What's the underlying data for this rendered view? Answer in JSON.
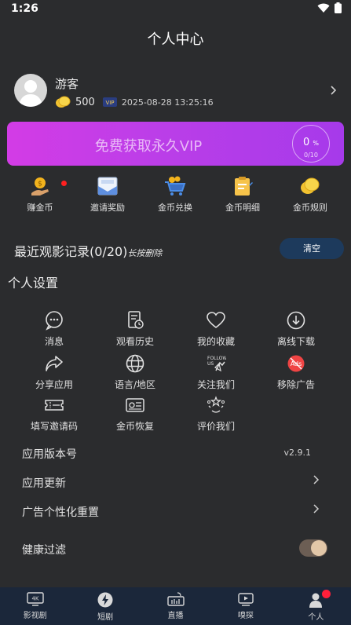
{
  "status": {
    "time": "1:26"
  },
  "header": {
    "title": "个人中心"
  },
  "profile": {
    "name": "游客",
    "coins": "500",
    "vip_badge": "VIP",
    "date": "2025-08-28 13:25:16"
  },
  "vip": {
    "label": "免费获取永久VIP",
    "percent": "0",
    "percent_sign": "%",
    "fraction": "0/10",
    "progress": 0
  },
  "coin_menu": [
    {
      "label": "赚金币",
      "icon": "earn-coins-icon"
    },
    {
      "label": "邀请奖励",
      "icon": "invite-icon"
    },
    {
      "label": "金币兑换",
      "icon": "coin-exchange-icon"
    },
    {
      "label": "金币明细",
      "icon": "coin-details-icon"
    },
    {
      "label": "金币规则",
      "icon": "coin-rules-icon"
    }
  ],
  "recent": {
    "title": "最近观影记录(0/20)",
    "hint": "长按删除",
    "clear_label": "清空"
  },
  "settings": {
    "title": "个人设置",
    "items": [
      {
        "label": "消息",
        "icon": "message-icon"
      },
      {
        "label": "观看历史",
        "icon": "history-icon"
      },
      {
        "label": "我的收藏",
        "icon": "heart-icon"
      },
      {
        "label": "离线下载",
        "icon": "download-icon"
      },
      {
        "label": "分享应用",
        "icon": "share-icon"
      },
      {
        "label": "语言/地区",
        "icon": "globe-icon"
      },
      {
        "label": "关注我们",
        "icon": "follow-us-icon"
      },
      {
        "label": "移除广告",
        "icon": "remove-ads-icon"
      },
      {
        "label": "填写邀请码",
        "icon": "ticket-icon"
      },
      {
        "label": "金币恢复",
        "icon": "coin-restore-icon"
      },
      {
        "label": "评价我们",
        "icon": "rate-icon"
      }
    ]
  },
  "rows": {
    "version_label": "应用版本号",
    "version_value": "v2.9.1",
    "update_label": "应用更新",
    "ad_reset_label": "广告个性化重置",
    "health_label": "健康过滤",
    "health_on": true
  },
  "nav": [
    {
      "label": "影视剧",
      "icon": "4k-icon"
    },
    {
      "label": "短剧",
      "icon": "lightning-icon"
    },
    {
      "label": "直播",
      "icon": "live-icon"
    },
    {
      "label": "嗅探",
      "icon": "sniff-icon"
    },
    {
      "label": "个人",
      "icon": "person-icon"
    }
  ],
  "colors": {
    "background": "#2b2c2e",
    "vip_gradient_start": "#d33ce6",
    "vip_gradient_end": "#a63aea",
    "nav_bg": "#1b273a",
    "clear_btn": "#1d3a5c",
    "badge": "#ff1f3a"
  }
}
